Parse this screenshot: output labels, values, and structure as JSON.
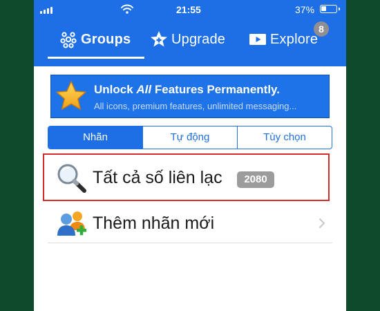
{
  "status_bar": {
    "time": "21:55",
    "battery_percent": "37%",
    "battery_level": 0.37
  },
  "nav": {
    "tabs": [
      {
        "label": "Groups",
        "icon": "groups-icon",
        "active": true
      },
      {
        "label": "Upgrade",
        "icon": "star-plus-icon",
        "active": false
      },
      {
        "label": "Explore",
        "icon": "play-icon",
        "active": false
      }
    ],
    "explore_badge": "8"
  },
  "banner": {
    "title_prefix": "Unlock ",
    "title_emphasis": "All",
    "title_suffix": " Features Permanently.",
    "subtitle": "All icons, premium features, unlimited messaging...",
    "icon": "gold-star-icon"
  },
  "segments": [
    {
      "label": "Nhãn",
      "active": true
    },
    {
      "label": "Tự động",
      "active": false
    },
    {
      "label": "Tùy chọn",
      "active": false
    }
  ],
  "list": {
    "all_contacts": {
      "label": "Tất cả số liên lạc",
      "count": "2080",
      "icon": "magnifier-icon"
    },
    "add_label": {
      "label": "Thêm nhãn mới",
      "icon": "add-group-icon"
    }
  },
  "colors": {
    "brand_blue": "#1e6fe6",
    "highlight_red": "#d62b2b",
    "background_green": "#0f4a2c"
  }
}
